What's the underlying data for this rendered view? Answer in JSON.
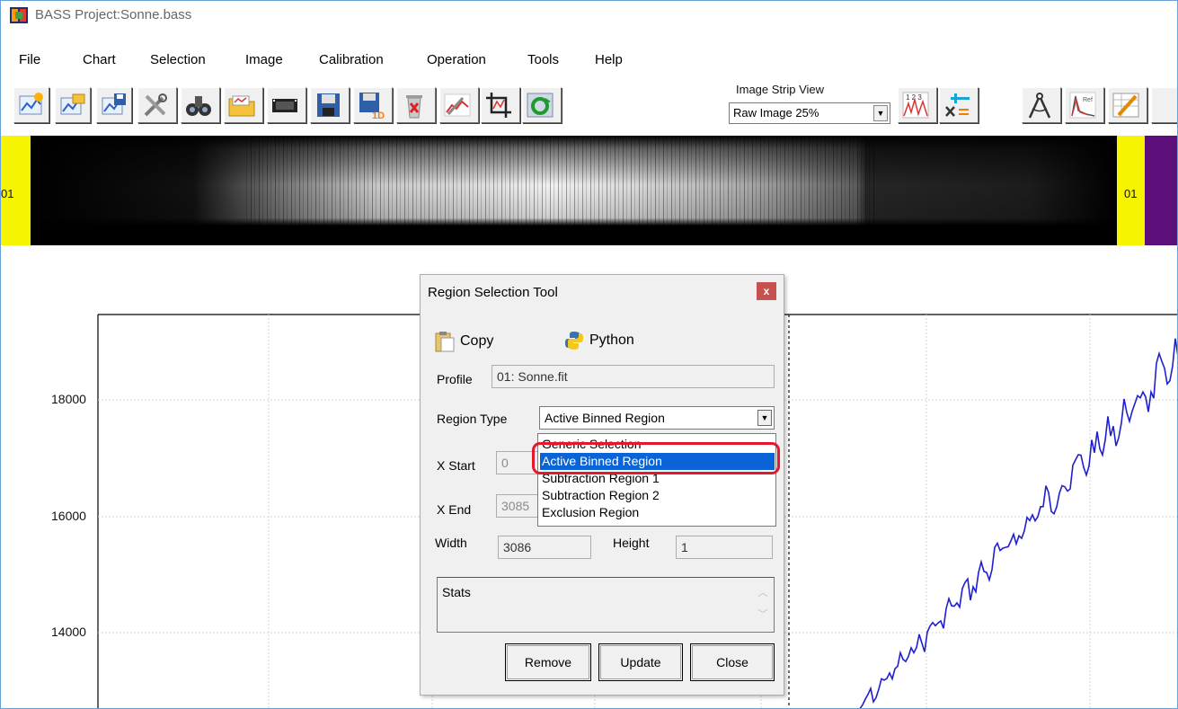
{
  "window": {
    "title": "BASS Project:Sonne.bass"
  },
  "menu": [
    "File",
    "Chart",
    "Selection",
    "Image",
    "Calibration",
    "Operation",
    "Tools",
    "Help"
  ],
  "toolbar": {
    "buttons": [
      "new-project-icon",
      "open-project-icon",
      "save-project-icon",
      "settings-tools-icon",
      "binoculars-icon",
      "open-folder-icon",
      "film-strip-icon",
      "save-icon",
      "save-1d-icon",
      "delete-icon",
      "tools-graph-icon",
      "crop-icon",
      "refresh-icon",
      "line-id-icon",
      "calculator-icon",
      "compass-icon",
      "reference-icon",
      "edit-chart-icon"
    ],
    "strip_label": "Image Strip View",
    "strip_value": "Raw Image 25%"
  },
  "strip": {
    "left_number": "01",
    "right_number": "01"
  },
  "chart_data": {
    "type": "line",
    "xlabel": "",
    "ylabel": "",
    "ytick_labels": [
      "18000",
      "16000",
      "14000"
    ],
    "series_color": "#1f1fd0",
    "grid": true
  },
  "dialog": {
    "title": "Region Selection Tool",
    "close": "x",
    "copy_label": "Copy",
    "python_label": "Python",
    "profile_label": "Profile",
    "profile_value": "01: Sonne.fit",
    "region_type_label": "Region Type",
    "region_type_value": "Active Binned Region",
    "region_options": [
      "Generic Selection",
      "Active Binned Region",
      "Subtraction Region 1",
      "Subtraction Region 2",
      "Exclusion Region"
    ],
    "x_start_label": "X Start",
    "x_start_value": "0",
    "x_end_label": "X End",
    "x_end_value": "3085",
    "width_label": "Width",
    "width_value": "3086",
    "height_label": "Height",
    "height_value": "1",
    "stats_label": "Stats",
    "remove_label": "Remove",
    "update_label": "Update",
    "close_label": "Close"
  }
}
